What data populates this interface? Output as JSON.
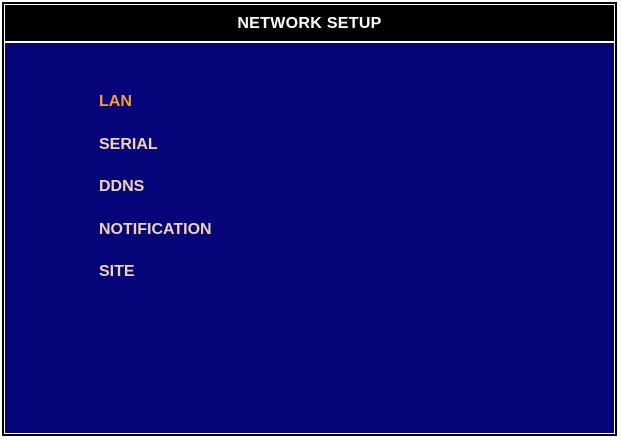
{
  "window": {
    "title": "NETWORK SETUP"
  },
  "menu": {
    "selected_index": 0,
    "items": [
      {
        "label": "LAN"
      },
      {
        "label": "SERIAL"
      },
      {
        "label": "DDNS"
      },
      {
        "label": "NOTIFICATION"
      },
      {
        "label": "SITE"
      }
    ]
  },
  "colors": {
    "background": "#040478",
    "titlebar": "#000000",
    "item_text": "#f0d2b4",
    "item_selected": "#ff9d30"
  }
}
